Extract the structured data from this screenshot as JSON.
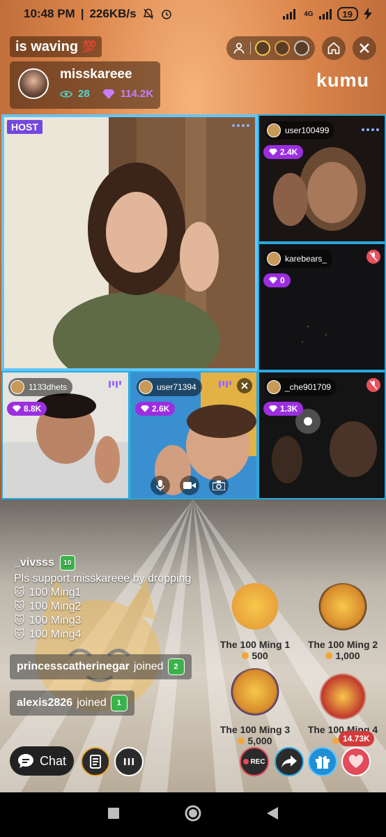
{
  "status_bar": {
    "time": "10:48 PM",
    "speed": "226KB/s",
    "network": "4G",
    "battery": "19"
  },
  "stream": {
    "activity": "is waving",
    "activity_emoji": "💯",
    "host_name": "misskareee",
    "viewers": "28",
    "diamonds": "114.2K",
    "brand": "kumu",
    "host_label": "HOST"
  },
  "guests": [
    {
      "username": "user100499",
      "gems": "2.4K"
    },
    {
      "username": "karebears_",
      "gems": "0"
    },
    {
      "username": "1133dhets",
      "gems": "8.8K"
    },
    {
      "username": "user71394",
      "gems": "2.6K"
    },
    {
      "username": "_che901709",
      "gems": "1.3K"
    }
  ],
  "chat": {
    "message_user": "_vivsss",
    "message_user_level": "10",
    "message_text": "Pls support misskareee by dropping",
    "ming_lines": [
      "100 Ming1",
      "100 Ming2",
      "100 Ming3",
      "100 Ming4"
    ],
    "joins": [
      {
        "user": "princesscatherinegar",
        "text": "joined",
        "level": "2"
      },
      {
        "user": "alexis2826",
        "text": "joined",
        "level": "1"
      }
    ]
  },
  "gifts": [
    {
      "name": "The 100 Ming 1",
      "price": "500"
    },
    {
      "name": "The 100 Ming 2",
      "price": "1,000"
    },
    {
      "name": "The 100 Ming 3",
      "price": "5,000"
    },
    {
      "name": "The 100 Ming 4",
      "price": "10"
    }
  ],
  "toolbar": {
    "chat_label": "Chat",
    "rec_label": "REC",
    "likes": "14.73K"
  },
  "colors": {
    "accent_cyan": "#2aa9e0",
    "gem_purple": "#9b2fe0",
    "host_label": "#7348e0",
    "heart_red": "#e24b5a"
  }
}
